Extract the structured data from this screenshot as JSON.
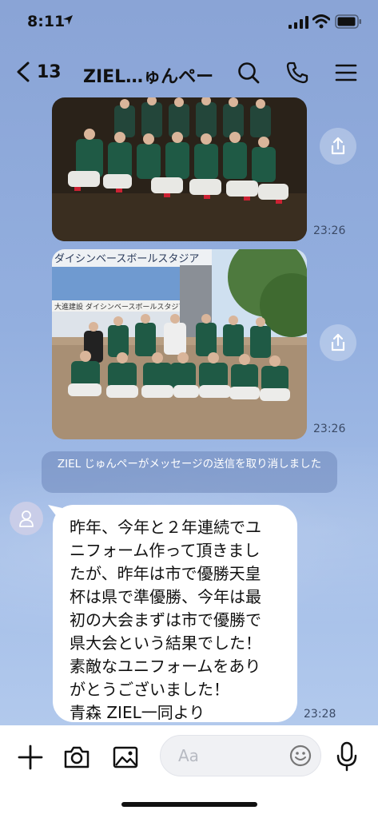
{
  "status_bar": {
    "time": "8:11"
  },
  "header": {
    "back_count": "13",
    "title": "ZIEL…ゅんペー"
  },
  "messages": {
    "photo1_time": "23:26",
    "photo2_time": "23:26",
    "photo2_sign_top": "ダイシンベースボールスタジア",
    "photo2_sign_banner": "大進建設 ダイシンベースボールスタジアム",
    "notice_text": "ZIEL じゅんペーがメッセージの送信を取り消しました",
    "bubble_lines": [
      "昨年、今年と２年連続でユ",
      "ニフォーム作って頂きまし",
      "たが、昨年は市で優勝天皇",
      "杯は県で準優勝、今年は最",
      "初の大会まずは市で優勝で",
      "県大会という結果でした！",
      "素敵なユニフォームをあり",
      "がとうございました！",
      "青森 ZIEL一同より"
    ],
    "bubble_time": "23:28"
  },
  "input_bar": {
    "placeholder": "Aa"
  },
  "colors": {
    "background": "#8fa9d8",
    "jersey_green": "#1f5a45",
    "bubble": "#ffffff"
  },
  "icons": [
    "back-chevron-icon",
    "search-icon",
    "phone-icon",
    "menu-icon",
    "share-icon",
    "avatar-icon",
    "plus-icon",
    "camera-icon",
    "image-icon",
    "emoji-icon",
    "mic-icon"
  ]
}
